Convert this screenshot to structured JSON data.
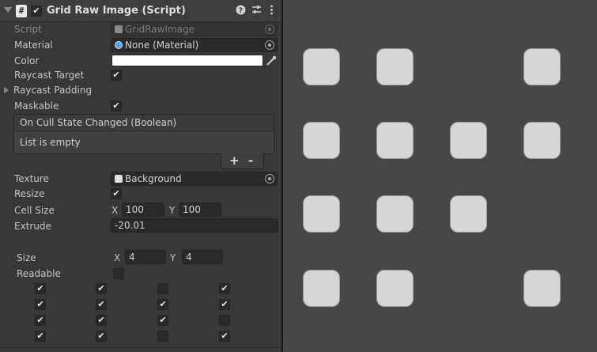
{
  "header": {
    "title": "Grid Raw Image (Script)",
    "script_glyph": "#",
    "enabled": true
  },
  "props": {
    "script": {
      "label": "Script",
      "value": "GridRawImage"
    },
    "material": {
      "label": "Material",
      "value": "None (Material)"
    },
    "color": {
      "label": "Color",
      "value": "#ffffff"
    },
    "raycast_target": {
      "label": "Raycast Target",
      "checked": true
    },
    "raycast_padding": {
      "label": "Raycast Padding"
    },
    "maskable": {
      "label": "Maskable",
      "checked": true
    },
    "event": {
      "title": "On Cull State Changed (Boolean)",
      "empty_text": "List is empty",
      "add": "+",
      "remove": "-"
    },
    "texture": {
      "label": "Texture",
      "value": "Background"
    },
    "resize": {
      "label": "Resize",
      "checked": true
    },
    "cell_size": {
      "label": "Cell Size",
      "x_label": "X",
      "x": "100",
      "y_label": "Y",
      "y": "100"
    },
    "extrude": {
      "label": "Extrude",
      "value": "-20.01"
    },
    "size": {
      "label": "Size",
      "x_label": "X",
      "x": "4",
      "y_label": "Y",
      "y": "4"
    },
    "readable": {
      "label": "Readable",
      "checked": false
    }
  },
  "grid": [
    [
      true,
      true,
      false,
      true
    ],
    [
      true,
      true,
      true,
      true
    ],
    [
      true,
      true,
      true,
      false
    ],
    [
      true,
      true,
      false,
      true
    ]
  ],
  "scene_grid": [
    [
      true,
      true,
      false,
      true
    ],
    [
      true,
      true,
      true,
      true
    ],
    [
      true,
      true,
      true,
      false
    ],
    [
      true,
      true,
      false,
      true
    ]
  ]
}
